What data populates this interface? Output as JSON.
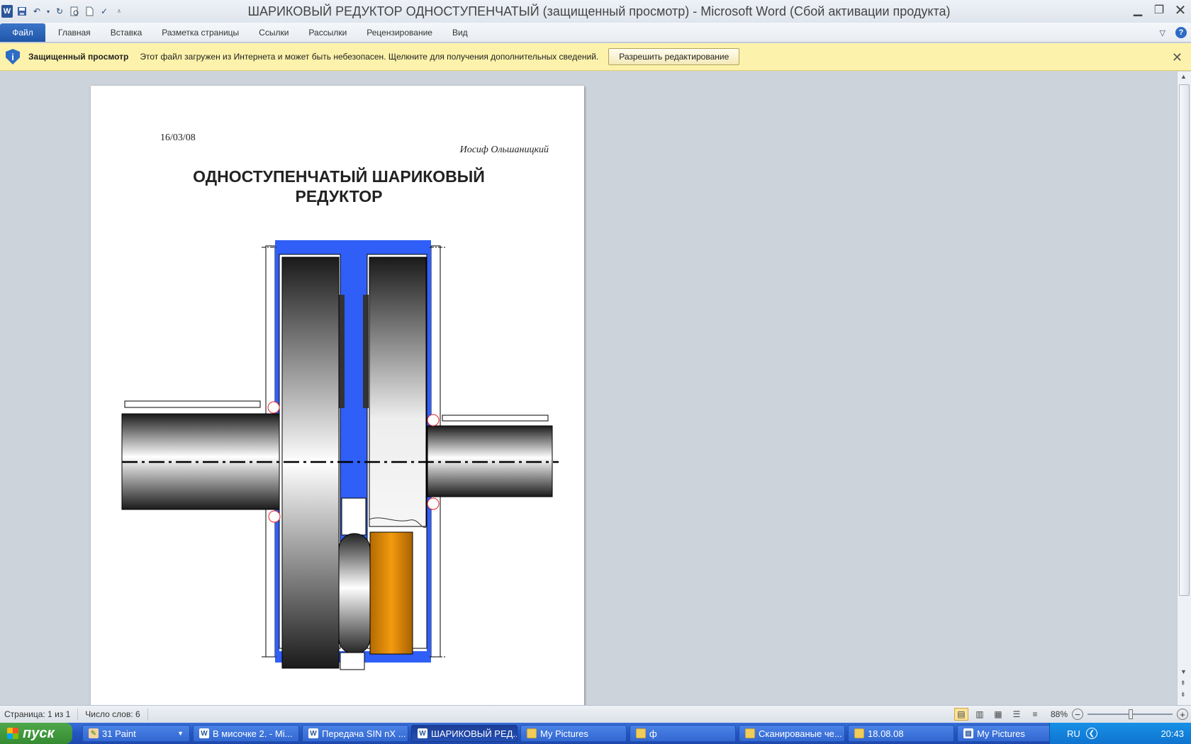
{
  "window": {
    "title": "ШАРИКОВЫЙ РЕДУКТОР ОДНОСТУПЕНЧАТЫЙ (защищенный просмотр)  -  Microsoft Word (Сбой активации продукта)",
    "app_letter": "W"
  },
  "ribbon": {
    "tabs": [
      "Файл",
      "Главная",
      "Вставка",
      "Разметка страницы",
      "Ссылки",
      "Рассылки",
      "Рецензирование",
      "Вид"
    ],
    "help": "?"
  },
  "message_bar": {
    "title": "Защищенный просмотр",
    "text": "Этот файл загружен из Интернета и может быть небезопасен. Щелкните для получения дополнительных сведений.",
    "button": "Разрешить редактирование",
    "icon": "shield-info-icon"
  },
  "document": {
    "date": "16/03/08",
    "author": "Иосиф Ольшаницкий",
    "title_line1": "ОДНОСТУПЕНЧАТЫЙ ШАРИКОВЫЙ",
    "title_line2": "РЕДУКТОР"
  },
  "status": {
    "page": "Страница: 1 из 1",
    "words": "Число слов: 6",
    "zoom": "88%",
    "zoom_fraction": 0.5
  },
  "taskbar": {
    "start": "пуск",
    "items": [
      {
        "label": "31 Paint",
        "icon": "paint"
      },
      {
        "label": "В мисочке 2. - Mi...",
        "icon": "word"
      },
      {
        "label": "Передача SIN nX ...",
        "icon": "word"
      },
      {
        "label": "ШАРИКОВЫЙ РЕД...",
        "icon": "word",
        "active": true
      },
      {
        "label": "My Pictures",
        "icon": "folder"
      },
      {
        "label": "ф",
        "icon": "folder"
      },
      {
        "label": "Сканированые че...",
        "icon": "folder"
      },
      {
        "label": "18.08.08",
        "icon": "folder"
      },
      {
        "label": "My Pictures",
        "icon": "doc"
      }
    ],
    "lang": "RU",
    "time": "20:43"
  },
  "colors": {
    "housing_blue": "#2f5ff7",
    "bearing_orange": "#f39a10",
    "highlight_red": "#e8232a"
  }
}
